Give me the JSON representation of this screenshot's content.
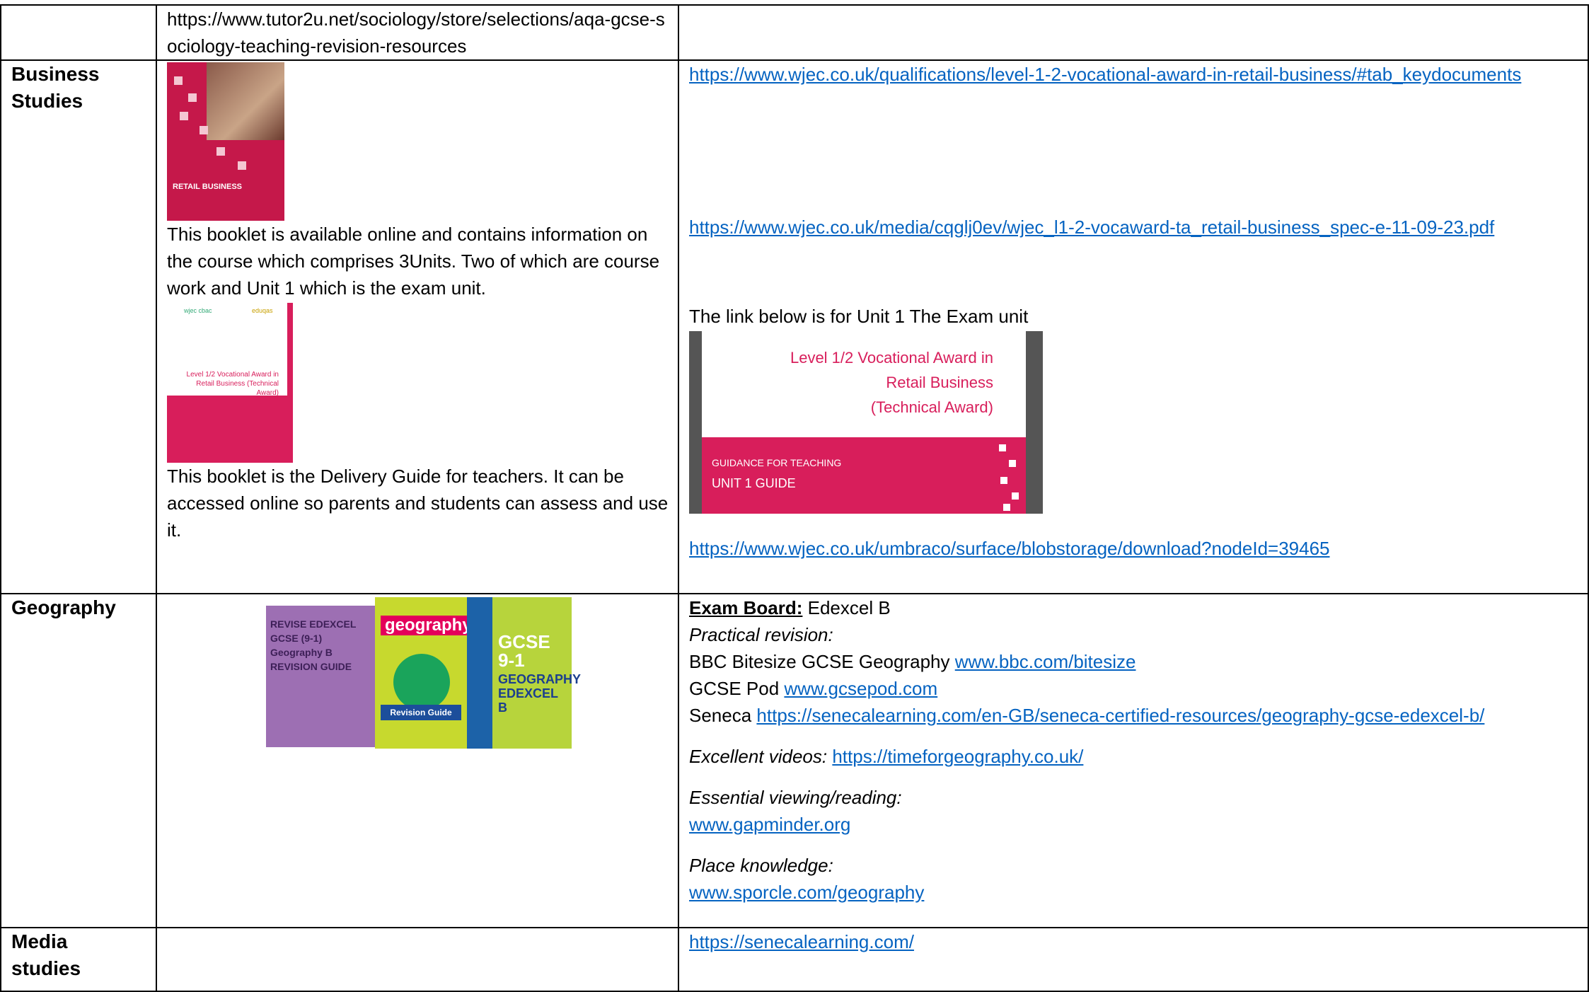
{
  "rows": {
    "sociology": {
      "resource_text": "https://www.tutor2u.net/sociology/store/selections/aqa-gcse-sociology-teaching-revision-resources"
    },
    "business": {
      "subject": "Business Studies",
      "cover1_text": "RETAIL BUSINESS",
      "booklet1_desc": "This booklet is available online and contains information on the course which comprises 3Units. Two of which are course work and Unit 1 which is the exam unit.",
      "cover2_text": "Level 1/2 Vocational Award in Retail Business (Technical Award)",
      "booklet2_desc": "This booklet is the Delivery Guide for teachers. It can be accessed online so parents and students can assess and use it.",
      "link1": "https://www.wjec.co.uk/qualifications/level-1-2-vocational-award-in-retail-business/#tab_keydocuments",
      "link2": "https://www.wjec.co.uk/media/cqglj0ev/wjec_l1-2-vocaward-ta_retail-business_spec-e-11-09-23.pdf",
      "unit1_intro": "The link below is for Unit 1 The Exam unit",
      "unit1_title_1": "Level 1/2 Vocational Award in",
      "unit1_title_2": "Retail Business",
      "unit1_title_3": "(Technical Award)",
      "unit1_guidance": "GUIDANCE FOR TEACHING",
      "unit1_guide": "UNIT 1 GUIDE",
      "link3": "https://www.wjec.co.uk/umbraco/surface/blobstorage/download?nodeId=39465"
    },
    "geography": {
      "subject": "Geography",
      "book1_text": "REVISE EDEXCEL GCSE (9-1) Geography B REVISION GUIDE",
      "book2_title": "geography",
      "book2_sub": "Revision Guide",
      "book3_title": "GCSE 9-1",
      "book3_sub": "GEOGRAPHY EDEXCEL B",
      "exam_board_label": "Exam Board:",
      "exam_board_value": " Edexcel B",
      "practical_label": "Practical revision:",
      "bbc_text": "BBC Bitesize GCSE Geography ",
      "bbc_link": "www.bbc.com/bitesize",
      "gcsepod_text": "GCSE Pod ",
      "gcsepod_link": "www.gcsepod.com",
      "seneca_text": "Seneca ",
      "seneca_link": "https://senecalearning.com/en-GB/seneca-certified-resources/geography-gcse-edexcel-b/",
      "videos_label": "Excellent videos:",
      "videos_link": "https://timeforgeography.co.uk/",
      "essential_label": "Essential viewing/reading:",
      "gapminder_link": "www.gapminder.org",
      "place_label": "Place knowledge:",
      "sporcle_link": "www.sporcle.com/geography"
    },
    "media": {
      "subject": "Media studies",
      "link": "https://senecalearning.com/"
    }
  }
}
